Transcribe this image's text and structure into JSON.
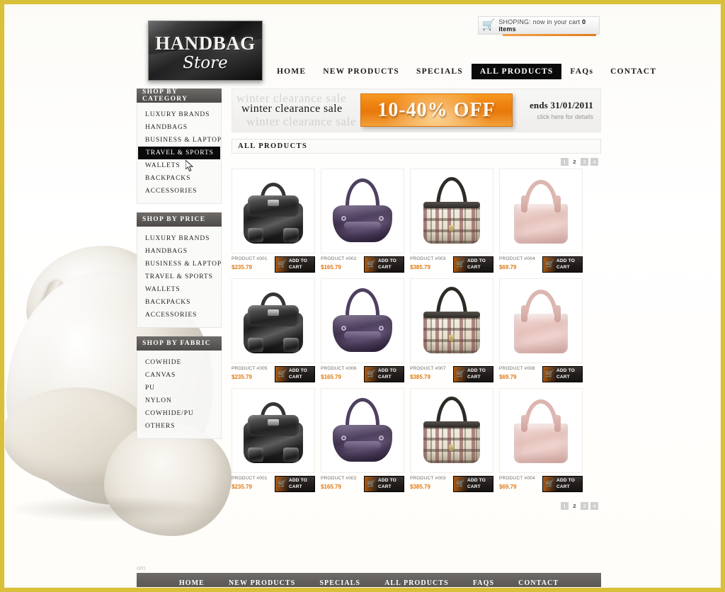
{
  "brand": {
    "line1": "HANDBAG",
    "line2": "Store"
  },
  "cart": {
    "icon": "shopping-cart-icon",
    "label": "SHOPING: now in your cart",
    "count": "0 items"
  },
  "topnav": {
    "items": [
      {
        "label": "HOME",
        "active": false
      },
      {
        "label": "NEW PRODUCTS",
        "active": false
      },
      {
        "label": "SPECIALS",
        "active": false
      },
      {
        "label": "ALL PRODUCTS",
        "active": true
      },
      {
        "label": "FAQs",
        "active": false
      },
      {
        "label": "CONTACT",
        "active": false
      }
    ]
  },
  "sidebar": {
    "panels": [
      {
        "title": "SHOP BY CATEGORY",
        "items": [
          {
            "label": "LUXURY BRANDS",
            "active": false
          },
          {
            "label": "HANDBAGS",
            "active": false
          },
          {
            "label": "BUSINESS & LAPTOP",
            "active": false
          },
          {
            "label": "TRAVEL & SPORTS",
            "active": true
          },
          {
            "label": "WALLETS",
            "active": false
          },
          {
            "label": "BACKPACKS",
            "active": false
          },
          {
            "label": "ACCESSORIES",
            "active": false
          }
        ]
      },
      {
        "title": "SHOP BY PRICE",
        "items": [
          {
            "label": "LUXURY BRANDS",
            "active": false
          },
          {
            "label": "HANDBAGS",
            "active": false
          },
          {
            "label": "BUSINESS & LAPTOP",
            "active": false
          },
          {
            "label": "TRAVEL & SPORTS",
            "active": false
          },
          {
            "label": "WALLETS",
            "active": false
          },
          {
            "label": "BACKPACKS",
            "active": false
          },
          {
            "label": "ACCESSORIES",
            "active": false
          }
        ]
      },
      {
        "title": "SHOP BY FABRIC",
        "items": [
          {
            "label": "COWHIDE",
            "active": false
          },
          {
            "label": "CANVAS",
            "active": false
          },
          {
            "label": "PU",
            "active": false
          },
          {
            "label": "NYLON",
            "active": false
          },
          {
            "label": "COWHIDE/PU",
            "active": false
          },
          {
            "label": "OTHERS",
            "active": false
          }
        ]
      }
    ]
  },
  "promo": {
    "ghost_top": "winter clearance sale",
    "title": "winter clearance sale",
    "ghost_bottom": "winter clearance sale",
    "badge": "10-40% OFF",
    "ends": "ends 31/01/2011",
    "details_link": "click here for details",
    "accent_color": "#ef8211"
  },
  "section": {
    "title": "ALL PRODUCTS"
  },
  "pager": {
    "pages": [
      "1",
      "2",
      "3",
      "4"
    ],
    "current": "2"
  },
  "products": {
    "add_to_cart_line1": "ADD TO",
    "add_to_cart_line2": "CART",
    "cart_icon": "cart-download-icon",
    "price_color": "#e07b14",
    "rows": [
      [
        {
          "name": "PRODUCT #001",
          "price": "$235.79",
          "art": "bag-001"
        },
        {
          "name": "PRODUCT #002",
          "price": "$165.79",
          "art": "bag-002"
        },
        {
          "name": "PRODUCT #003",
          "price": "$385.79",
          "art": "bag-003"
        },
        {
          "name": "PRODUCT #004",
          "price": "$69.79",
          "art": "bag-004"
        }
      ],
      [
        {
          "name": "PRODUCT #005",
          "price": "$235.79",
          "art": "bag-001"
        },
        {
          "name": "PRODUCT #006",
          "price": "$165.79",
          "art": "bag-002"
        },
        {
          "name": "PRODUCT #007",
          "price": "$385.79",
          "art": "bag-003"
        },
        {
          "name": "PRODUCT #008",
          "price": "$69.79",
          "art": "bag-004"
        }
      ],
      [
        {
          "name": "PRODUCT #001",
          "price": "$235.79",
          "art": "bag-001"
        },
        {
          "name": "PRODUCT #002",
          "price": "$165.79",
          "art": "bag-002"
        },
        {
          "name": "PRODUCT #003",
          "price": "$385.79",
          "art": "bag-003"
        },
        {
          "name": "PRODUCT #004",
          "price": "$69.79",
          "art": "bag-004"
        }
      ]
    ]
  },
  "footer": {
    "ghost": "om",
    "items": [
      "HOME",
      "NEW PRODUCTS",
      "SPECIALS",
      "ALL PRODUCTS",
      "FAQS",
      "CONTACT"
    ]
  }
}
